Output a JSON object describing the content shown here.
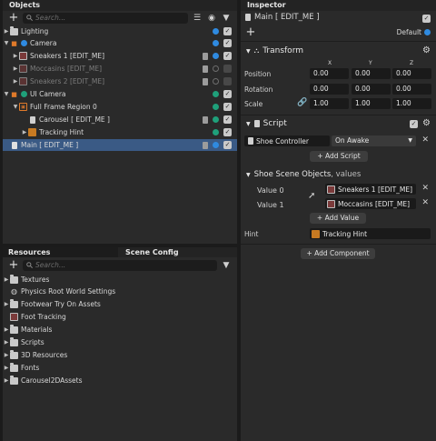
{
  "objects": {
    "title": "Objects",
    "search_placeholder": "Search...",
    "rows": [
      {
        "label": "Lighting",
        "dim": false
      },
      {
        "label": "Camera",
        "dim": false
      },
      {
        "label": "Sneakers 1 [EDIT_ME]",
        "dim": false
      },
      {
        "label": "Moccasins [EDIT_ME]",
        "dim": true
      },
      {
        "label": "Sneakers 2 [EDIT_ME]",
        "dim": true
      },
      {
        "label": "UI Camera",
        "dim": false
      },
      {
        "label": "Full Frame Region 0",
        "dim": false
      },
      {
        "label": "Carousel [ EDIT_ME ]",
        "dim": false
      },
      {
        "label": "Tracking Hint",
        "dim": false
      },
      {
        "label": "Main [ EDIT_ME ]",
        "dim": false
      }
    ]
  },
  "resources": {
    "tab_resources": "Resources",
    "tab_scene_config": "Scene Config",
    "search_placeholder": "Search...",
    "items": [
      {
        "label": "Textures"
      },
      {
        "label": "Physics Root World Settings"
      },
      {
        "label": "Footwear Try On Assets"
      },
      {
        "label": "Foot Tracking"
      },
      {
        "label": "Materials"
      },
      {
        "label": "Scripts"
      },
      {
        "label": "3D Resources"
      },
      {
        "label": "Fonts"
      },
      {
        "label": "Carousel2DAssets"
      }
    ]
  },
  "inspector": {
    "title": "Inspector",
    "object_name": "Main [ EDIT_ME ]",
    "layer_label": "Default",
    "transform": {
      "title": "Transform",
      "axis_x": "X",
      "axis_y": "Y",
      "axis_z": "Z",
      "position_label": "Position",
      "rotation_label": "Rotation",
      "scale_label": "Scale",
      "position": [
        "0.00",
        "0.00",
        "0.00"
      ],
      "rotation": [
        "0.00",
        "0.00",
        "0.00"
      ],
      "scale": [
        "1.00",
        "1.00",
        "1.00"
      ]
    },
    "script": {
      "title": "Script",
      "script_name": "Shoe Controller",
      "event": "On Awake",
      "add_script": "+ Add Script"
    },
    "shoe_objects": {
      "title": "Shoe Scene Objects",
      "suffix": ", values",
      "value0_label": "Value 0",
      "value0": "Sneakers 1 [EDIT_ME]",
      "value1_label": "Value 1",
      "value1": "Moccasins [EDIT_ME]",
      "add_value": "+ Add Value"
    },
    "hint": {
      "label": "Hint",
      "value": "Tracking Hint"
    },
    "add_component": "+ Add Component"
  }
}
